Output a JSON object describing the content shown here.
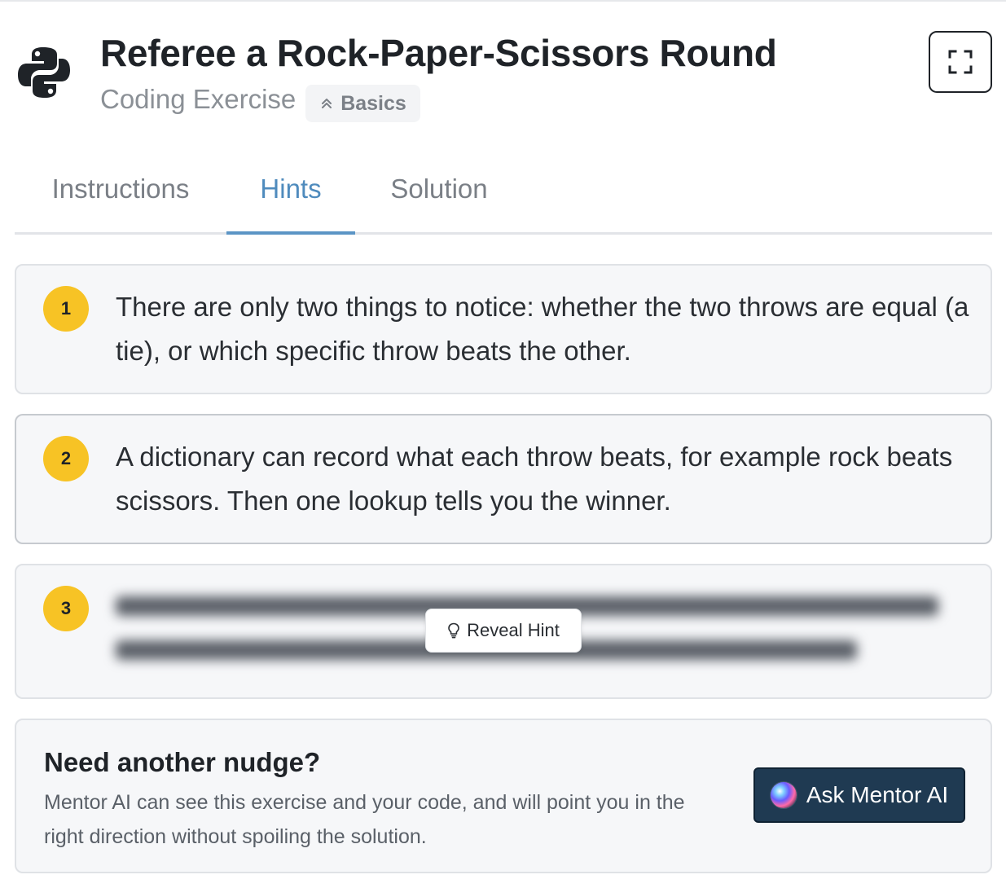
{
  "header": {
    "title": "Referee a Rock-Paper-Scissors Round",
    "subtitle": "Coding Exercise",
    "level": "Basics"
  },
  "tabs": [
    {
      "label": "Instructions",
      "active": false
    },
    {
      "label": "Hints",
      "active": true
    },
    {
      "label": "Solution",
      "active": false
    }
  ],
  "hints": [
    {
      "number": "1",
      "text": "There are only two things to notice: whether the two throws are equal (a tie), or which specific throw beats the other.",
      "revealed": true
    },
    {
      "number": "2",
      "text": "A dictionary can record what each throw beats, for example rock beats scissors. Then one lookup tells you the winner.",
      "revealed": true
    },
    {
      "number": "3",
      "revealed": false,
      "reveal_label": "Reveal Hint"
    }
  ],
  "mentor": {
    "title": "Need another nudge?",
    "description": "Mentor AI can see this exercise and your code, and will point you in the right direction without spoiling the solution.",
    "button_label": "Ask Mentor AI"
  },
  "colors": {
    "accent": "#5b95c5",
    "badge_yellow": "#f7c325",
    "mentor_button": "#1f3a52"
  }
}
